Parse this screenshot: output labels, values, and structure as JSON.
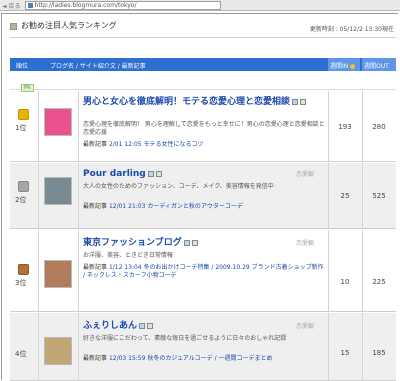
{
  "browser": {
    "back_label": "◄ 戻る",
    "url": "http://ladies.blogmura.com/tokyo/"
  },
  "page": {
    "title": "お勧め注目人気ランキング",
    "updated": "更新時刻 : 05/12/2 13:30現在"
  },
  "table_header": {
    "rank": "順位",
    "blog": "ブログ名 / サイト紹介文 / 最新記事",
    "title_col": "",
    "in": "週間IN",
    "out": "週間OUT"
  },
  "pr_label": "PR",
  "rows": [
    {
      "rank_label": "1位",
      "title": "男心と女心を徹底解明！モテる恋愛心理と恋愛相談",
      "genre": "",
      "desc": "恋愛心理を徹底解明！ 男心を理解して恋愛をもっと幸せに！男心の恋愛心理と恋愛相談と恋愛応援",
      "latest_label": "最新記事",
      "latest": "2/01 12:05 モテる女性になるコツ",
      "in": "193",
      "out": "280",
      "rank_color": "#e8b400"
    },
    {
      "rank_label": "2位",
      "title": "Pour darling",
      "genre": "恋愛観",
      "desc": "大人の女性のためのファッション、コーデ、メイク、美容情報を発信中",
      "latest_label": "最新記事",
      "latest": "12/01 21:03 カーディガンと秋のアウターコーデ",
      "in": "25",
      "out": "525",
      "rank_color": "#a0a0a0"
    },
    {
      "rank_label": "3位",
      "title": "東京ファッションブログ",
      "genre": "恋愛観",
      "desc": "お洋服、美容、ときどき日常情報",
      "latest_label": "最新記事",
      "latest": "1/12 13:04 冬のお出かけコーデ特集 / 2009.10.29 ブランド古着ショップ新作 / ネックレス・スカーフ小物コーデ",
      "in": "10",
      "out": "225",
      "rank_color": "#b0703a"
    },
    {
      "rank_label": "4位",
      "title": "ふぇりしあん",
      "genre": "恋愛観",
      "desc": "好きな洋服にこだわって、素敵な毎日を過ごせるように日々のおしゃれ記録",
      "latest_label": "最新記事",
      "latest": "12/03 15:59 秋冬のカジュアルコーデ / 一週間コーデまとめ",
      "in": "15",
      "out": "185",
      "rank_color": ""
    }
  ]
}
